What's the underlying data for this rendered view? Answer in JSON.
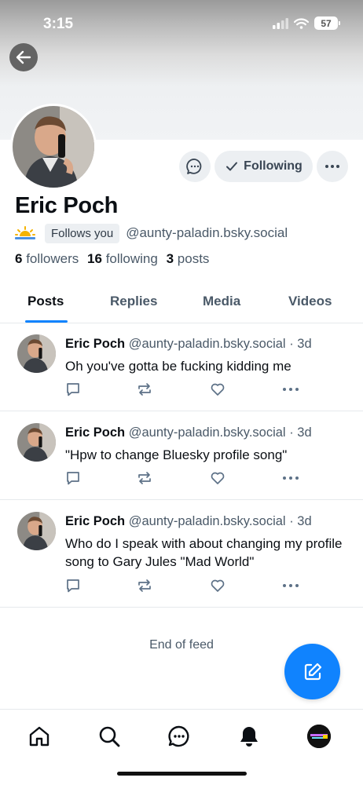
{
  "status_bar": {
    "time": "3:15",
    "battery": "57"
  },
  "profile": {
    "display_name": "Eric Poch",
    "follows_you": "Follows you",
    "handle": "@aunty-paladin.bsky.social",
    "followers_count": "6",
    "followers_label": "followers",
    "following_count": "16",
    "following_label": "following",
    "posts_count": "3",
    "posts_label": "posts",
    "following_button": "Following"
  },
  "tabs": [
    "Posts",
    "Replies",
    "Media",
    "Videos"
  ],
  "posts": [
    {
      "name": "Eric Poch",
      "handle": "@aunty-paladin.bsky.social",
      "time": " · 3d",
      "text": "Oh you've gotta be fucking kidding me"
    },
    {
      "name": "Eric Poch",
      "handle": "@aunty-paladin.bsky.social",
      "time": " · 3d",
      "text": "\"Hpw to change Bluesky profile song\""
    },
    {
      "name": "Eric Poch",
      "handle": "@aunty-paladin.bsky.social",
      "time": " · 3d",
      "text": "Who do I speak with about changing my profile song to Gary Jules \"Mad World\""
    }
  ],
  "feed_end": "End of feed",
  "colors": {
    "accent": "#1083fe",
    "muted_text": "#4a5968",
    "button_bg": "#eceff2"
  },
  "icons": {
    "back": "arrow-left-icon",
    "message": "chat-bubble-icon",
    "following": "checkmark-icon",
    "more": "ellipsis-icon",
    "compose": "compose-icon",
    "nav": [
      "home-icon",
      "search-icon",
      "chat-icon",
      "bell-icon",
      "profile-avatar"
    ]
  }
}
